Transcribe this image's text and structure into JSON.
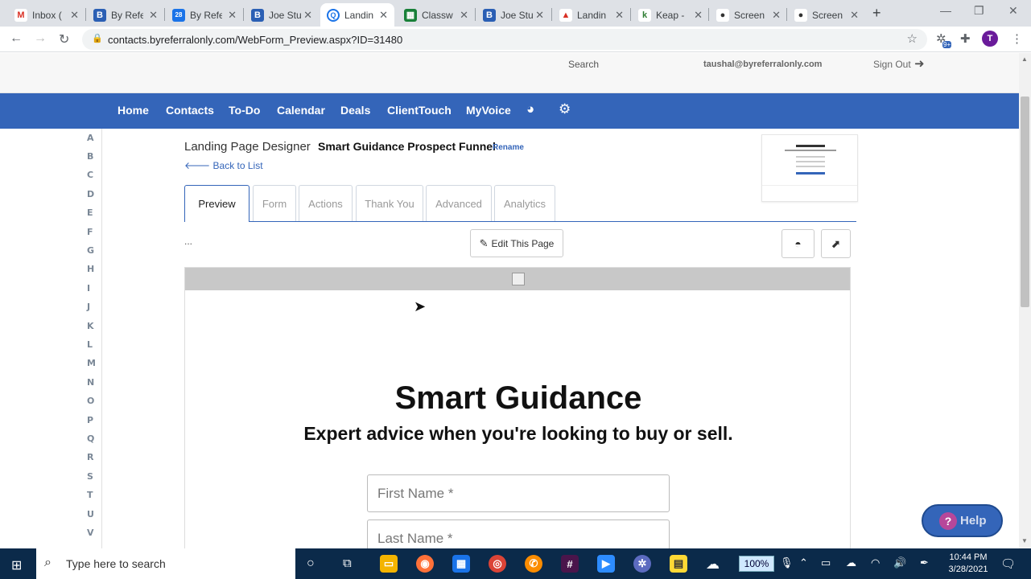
{
  "browser": {
    "tabs": [
      {
        "label": "Inbox (",
        "favicon": "gmail-icon",
        "color": "#d93025",
        "glyph": "M"
      },
      {
        "label": "By Refe",
        "favicon": "by-referral-icon",
        "color": "#2b5fb4",
        "glyph": "B"
      },
      {
        "label": "By Refe",
        "favicon": "calendar-icon",
        "color": "#1a73e8",
        "glyph": "28"
      },
      {
        "label": "Joe Stu",
        "favicon": "by-referral-icon",
        "color": "#2b5fb4",
        "glyph": "B"
      },
      {
        "label": "Landin",
        "favicon": "landing-icon",
        "color": "#1a73e8",
        "glyph": "Q"
      },
      {
        "label": "Classw",
        "favicon": "sheets-icon",
        "color": "#188038",
        "glyph": "▦"
      },
      {
        "label": "Joe Stu",
        "favicon": "by-referral-icon",
        "color": "#2b5fb4",
        "glyph": "B"
      },
      {
        "label": "Landin",
        "favicon": "landing-red-icon",
        "color": "#d93025",
        "glyph": "▲"
      },
      {
        "label": "Keap -",
        "favicon": "keap-icon",
        "color": "#2e7d32",
        "glyph": "k"
      },
      {
        "label": "Screen",
        "favicon": "screencast-icon",
        "color": "#333333",
        "glyph": "●"
      },
      {
        "label": "Screen",
        "favicon": "screencast-icon",
        "color": "#333333",
        "glyph": "●"
      }
    ],
    "active_tab": 4,
    "url": "contacts.byreferralonly.com/WebForm_Preview.aspx?ID=31480",
    "badge": "9+",
    "profile_initial": "T"
  },
  "header": {
    "search": "Search",
    "email": "taushal@byreferralonly.com",
    "sign_out": "Sign Out"
  },
  "nav": {
    "items": [
      "Home",
      "Contacts",
      "To-Do",
      "Calendar",
      "Deals",
      "ClientTouch",
      "MyVoice"
    ]
  },
  "alphabet": [
    "A",
    "B",
    "C",
    "D",
    "E",
    "F",
    "G",
    "H",
    "I",
    "J",
    "K",
    "L",
    "M",
    "N",
    "O",
    "P",
    "Q",
    "R",
    "S",
    "T",
    "U",
    "V"
  ],
  "designer": {
    "label": "Landing Page Designer",
    "page_name": "Smart Guidance Prospect Funnel",
    "rename": "Rename",
    "back": "Back to List",
    "tabs": [
      "Preview",
      "Form",
      "Actions",
      "Thank You",
      "Advanced",
      "Analytics"
    ],
    "active_tab": "Preview",
    "ellipsis": "...",
    "edit_button": "Edit This Page"
  },
  "preview": {
    "title": "Smart Guidance",
    "subtitle": "Expert advice when you're looking to buy or sell.",
    "first_name_placeholder": "First Name *",
    "last_name_placeholder": "Last Name *"
  },
  "help": {
    "label": "Help"
  },
  "taskbar": {
    "search_placeholder": "Type here to search",
    "zoom": "100%",
    "time": "10:44 PM",
    "date": "3/28/2021"
  },
  "colors": {
    "brand": "#3465b9",
    "taskbar": "#0b2a4a"
  }
}
